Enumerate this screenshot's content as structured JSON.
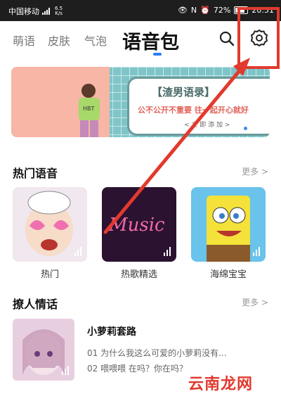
{
  "statusbar": {
    "carrier": "中国移动",
    "speed_value": "6.5",
    "speed_unit": "K/s",
    "battery": "72%",
    "time": "20:51"
  },
  "tabs": [
    {
      "label": "萌语"
    },
    {
      "label": "皮肤"
    },
    {
      "label": "气泡"
    },
    {
      "label": "语音包"
    }
  ],
  "icons": {
    "search": "search-icon",
    "settings": "gear-icon"
  },
  "banner": {
    "title": "【渣男语录】",
    "subtitle": "公不公开不重要 往一起开心就好",
    "button": "< 立 即 添 加 >"
  },
  "hot": {
    "title": "热门语音",
    "more": "更多 >",
    "items": [
      {
        "label": "热门"
      },
      {
        "label": "热歌精选"
      },
      {
        "label": "海绵宝宝"
      }
    ],
    "music_text": "Music"
  },
  "flirt": {
    "title": "撩人情话",
    "more": "更多 >",
    "item": {
      "title": "小萝莉套路",
      "line1": "01 为什么我这么可爱的小萝莉没有...",
      "line2": "02 喂喂喂 在吗？你在吗？"
    }
  },
  "watermark": "云南龙网",
  "colors": {
    "accent": "#2a7df3",
    "annotation": "#e23a2e"
  }
}
